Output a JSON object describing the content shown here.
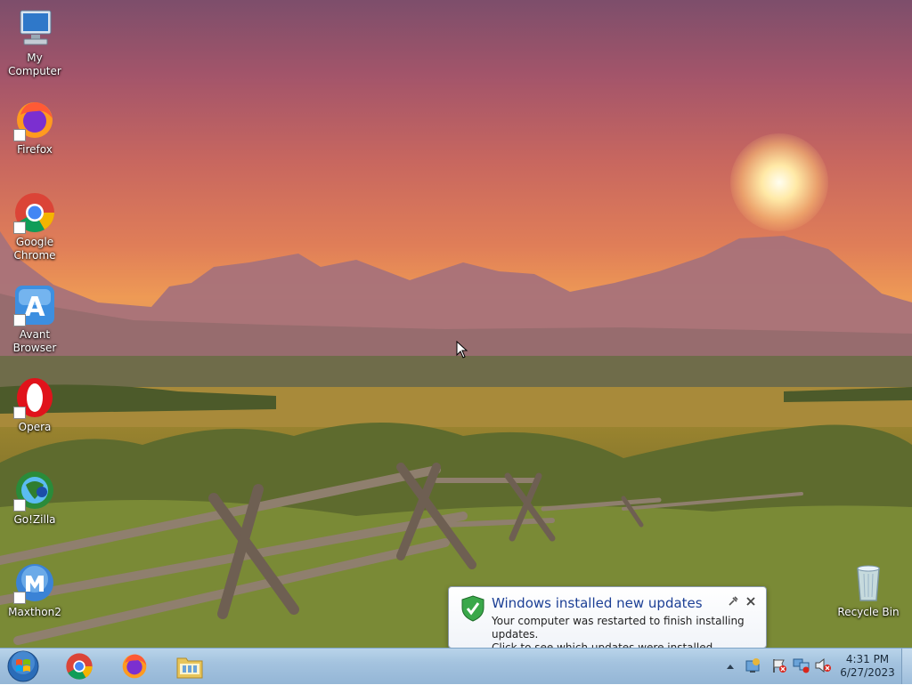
{
  "desktop": {
    "icons": [
      {
        "label": "My Computer",
        "icon": "computer-icon"
      },
      {
        "label": "Firefox",
        "icon": "firefox-icon"
      },
      {
        "label": "Google Chrome",
        "icon": "chrome-icon"
      },
      {
        "label": "Avant Browser",
        "icon": "avant-browser-icon"
      },
      {
        "label": "Opera",
        "icon": "opera-icon"
      },
      {
        "label": "Go!Zilla",
        "icon": "gozilla-icon"
      },
      {
        "label": "Maxthon2",
        "icon": "maxthon-icon"
      },
      {
        "label": "Recycle Bin",
        "icon": "recycle-bin-icon"
      }
    ]
  },
  "notification": {
    "title": "Windows installed new updates",
    "line1": "Your computer was restarted to finish installing updates.",
    "line2": "Click to see which updates were installed."
  },
  "taskbar": {
    "pinned": [
      "chrome-icon",
      "firefox-icon",
      "file-explorer-icon"
    ],
    "clock": {
      "time": "4:31 PM",
      "date": "6/27/2023"
    }
  },
  "colors": {
    "taskbar": "#a4c3df",
    "balloon_title": "#1c3f95",
    "sky_top": "#7d4e6b",
    "sky_glow": "#ee9a55"
  }
}
